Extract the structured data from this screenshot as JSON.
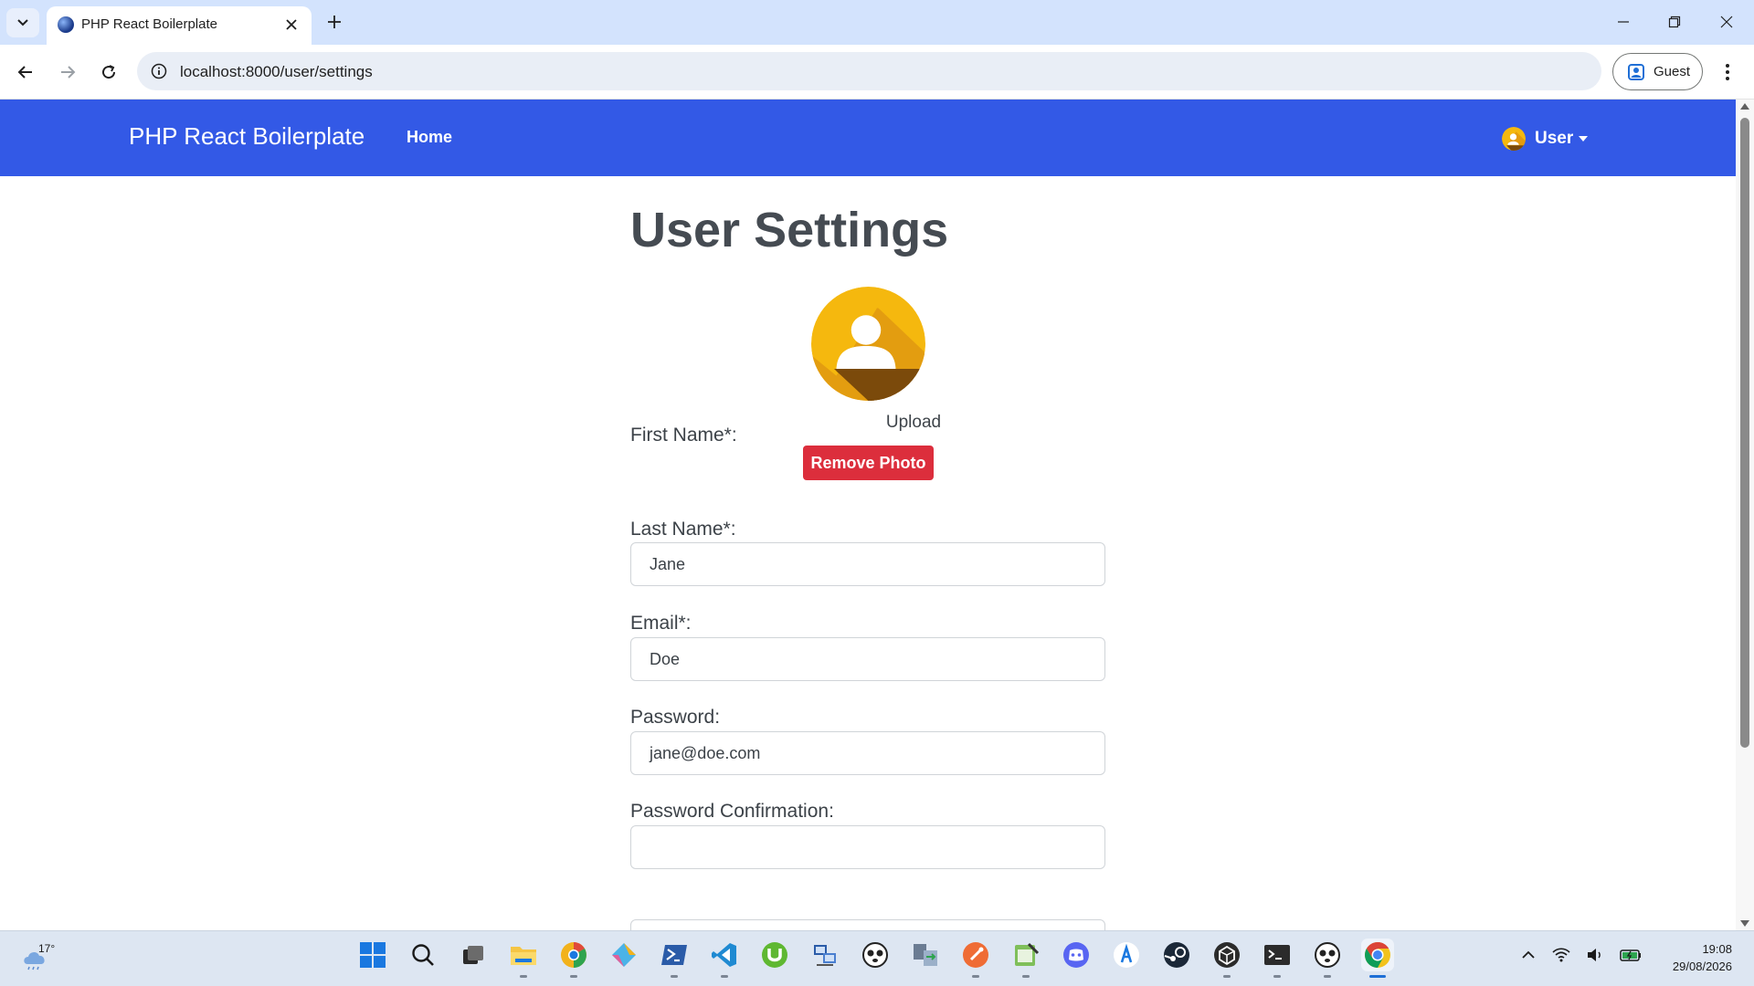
{
  "browser": {
    "tab_title": "PHP React Boilerplate",
    "url": "localhost:8000/user/settings",
    "profile_label": "Guest"
  },
  "app": {
    "brand": "PHP React Boilerplate",
    "nav_home": "Home",
    "user_menu_label": "User",
    "accent_color": "#3359e6"
  },
  "settings": {
    "title": "User Settings",
    "upload_label": "Upload",
    "remove_photo_label": "Remove Photo",
    "fields": [
      {
        "label": "First Name*:",
        "value": "Jane"
      },
      {
        "label": "Last Name*:",
        "value": "Doe"
      },
      {
        "label": "Email*:",
        "value": "jane@doe.com"
      },
      {
        "label": "Password:",
        "value": ""
      },
      {
        "label": "Password Confirmation:",
        "value": ""
      }
    ]
  },
  "taskbar": {
    "weather_temp": "17°",
    "time": "19:08",
    "date": "29/08/2026",
    "apps": [
      "start-icon",
      "search-icon",
      "task-view-icon",
      "file-explorer-icon",
      "chrome-canary-icon",
      "git-icon",
      "powershell-icon",
      "vscode-icon",
      "utorrent-icon",
      "network-tool-icon",
      "panda-app-icon",
      "file-transfer-icon",
      "postman-icon",
      "notepad-icon",
      "discord-icon",
      "app-store-icon",
      "steam-icon",
      "unity-icon",
      "terminal-icon",
      "panda-app-icon",
      "chrome-icon"
    ]
  }
}
